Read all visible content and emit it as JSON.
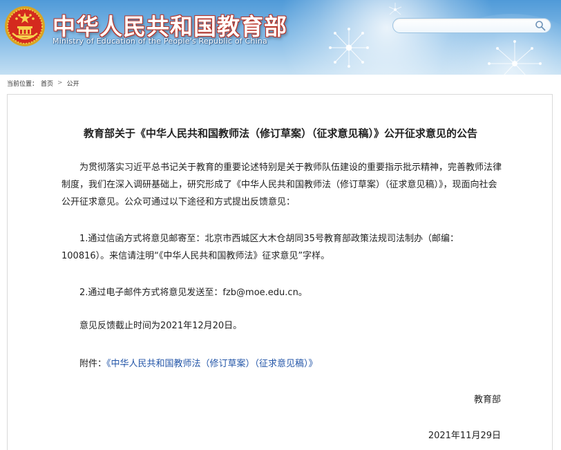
{
  "header": {
    "title": "中华人民共和国教育部",
    "subtitle": "Ministry of Education of the People's Republic of China",
    "search": {
      "value": "",
      "placeholder": ""
    }
  },
  "breadcrumb": {
    "label": "当前位置：",
    "items": [
      "首页",
      "公开"
    ],
    "separator": ">"
  },
  "article": {
    "title": "教育部关于《中华人民共和国教师法（修订草案）（征求意见稿）》公开征求意见的公告",
    "paragraphs": [
      "为贯彻落实习近平总书记关于教育的重要论述特别是关于教师队伍建设的重要指示批示精神，完善教师法律制度，我们在深入调研基础上，研究形成了《中华人民共和国教师法（修订草案）（征求意见稿）》，现面向社会公开征求意见。公众可通过以下途径和方式提出反馈意见：",
      "1.通过信函方式将意见邮寄至：北京市西城区大木仓胡同35号教育部政策法规司法制办（邮编：100816）。来信请注明“《中华人民共和国教师法》征求意见”字样。",
      "2.通过电子邮件方式将意见发送至：fzb@moe.edu.cn。",
      "意见反馈截止时间为2021年12月20日。"
    ],
    "attachment_label": "附件：",
    "attachment_link": "《中华人民共和国教师法（修订草案）（征求意见稿）》",
    "signature": "教育部",
    "date": "2021年11月29日"
  },
  "colors": {
    "header_top": "#4f9ad8",
    "header_bottom": "#c3dff3",
    "title_outline": "#b5342a",
    "link": "#2456a8",
    "text": "#222222",
    "border": "#d9d9d9"
  },
  "icons": {
    "emblem": "national-emblem-icon",
    "search": "search-icon",
    "decoration": "dandelion-icon"
  }
}
